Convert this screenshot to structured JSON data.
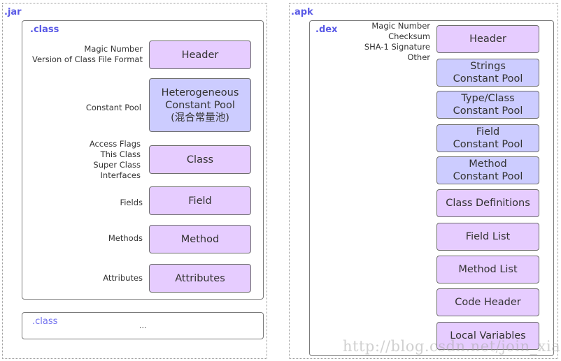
{
  "jar": {
    "title": ".jar",
    "class_main": {
      "title": ".class",
      "rows": [
        {
          "label": "Magic Number\nVersion of Class File Format",
          "box": "Header",
          "color": "#e6ccff"
        },
        {
          "label": "Constant Pool",
          "box": "Heterogeneous\nConstant Pool\n(混合常量池)",
          "color": "#ccccff"
        },
        {
          "label": "Access Flags\nThis Class\nSuper Class\nInterfaces",
          "box": "Class",
          "color": "#e6ccff"
        },
        {
          "label": "Fields",
          "box": "Field",
          "color": "#e6ccff"
        },
        {
          "label": "Methods",
          "box": "Method",
          "color": "#e6ccff"
        },
        {
          "label": "Attributes",
          "box": "Attributes",
          "color": "#e6ccff"
        }
      ]
    },
    "class_more": {
      "title": ".class",
      "content": "..."
    }
  },
  "apk": {
    "title": ".apk",
    "dex": {
      "title": ".dex",
      "header_label": "Magic Number\nChecksum\nSHA-1 Signature\nOther",
      "boxes": [
        {
          "text": "Header",
          "color": "#e6ccff"
        },
        {
          "text": "Strings\nConstant Pool",
          "color": "#ccccff"
        },
        {
          "text": "Type/Class\nConstant Pool",
          "color": "#ccccff"
        },
        {
          "text": "Field\nConstant Pool",
          "color": "#ccccff"
        },
        {
          "text": "Method\nConstant Pool",
          "color": "#ccccff"
        },
        {
          "text": "Class Definitions",
          "color": "#e6ccff"
        },
        {
          "text": "Field List",
          "color": "#e6ccff"
        },
        {
          "text": "Method List",
          "color": "#e6ccff"
        },
        {
          "text": "Code Header",
          "color": "#e6ccff"
        },
        {
          "text": "Local Variables",
          "color": "#e6ccff"
        }
      ]
    }
  },
  "watermark": "http://blog.csdn.net/join_xiao"
}
